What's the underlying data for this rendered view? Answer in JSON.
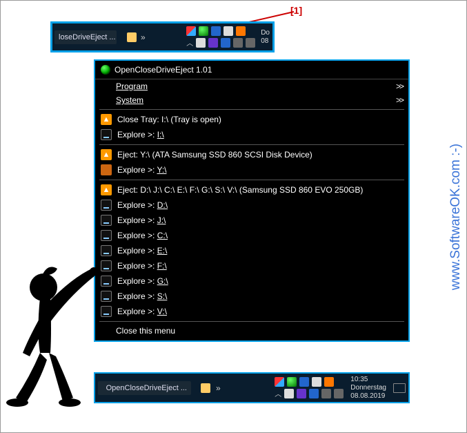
{
  "callout": {
    "label": "[1]"
  },
  "taskbar_top": {
    "task_button": "loseDriveEject ...",
    "clock_line": "Do",
    "date_line": "08"
  },
  "menu": {
    "title": "OpenCloseDriveEject 1.01",
    "program_label": "Program",
    "system_label": "System",
    "close_tray": "Close Tray: I:\\ (Tray is open)",
    "explore_i_pre": "Explore >: ",
    "explore_i_drv": "I:\\",
    "eject_y": "Eject: Y:\\  (ATA Samsung SSD 860 SCSI Disk Device)",
    "explore_y_pre": "Explore >: ",
    "explore_y_drv": "Y:\\",
    "eject_multi": "Eject: D:\\ J:\\ C:\\ E:\\ F:\\ G:\\ S:\\ V:\\  (Samsung SSD 860 EVO 250GB)",
    "explore_pre": "Explore >: ",
    "drv_d": "D:\\",
    "drv_j": "J:\\",
    "drv_c": "C:\\",
    "drv_e": "E:\\",
    "drv_f": "F:\\",
    "drv_g": "G:\\",
    "drv_s": "S:\\",
    "drv_v": "V:\\",
    "close_menu": "Close this menu",
    "arrow": ">>"
  },
  "taskbar_bottom": {
    "task_button": "OpenCloseDriveEject ...",
    "time": "10:35",
    "weekday": "Donnerstag",
    "date": "08.08.2019"
  },
  "watermark": "www.SoftwareOK.com :-)"
}
